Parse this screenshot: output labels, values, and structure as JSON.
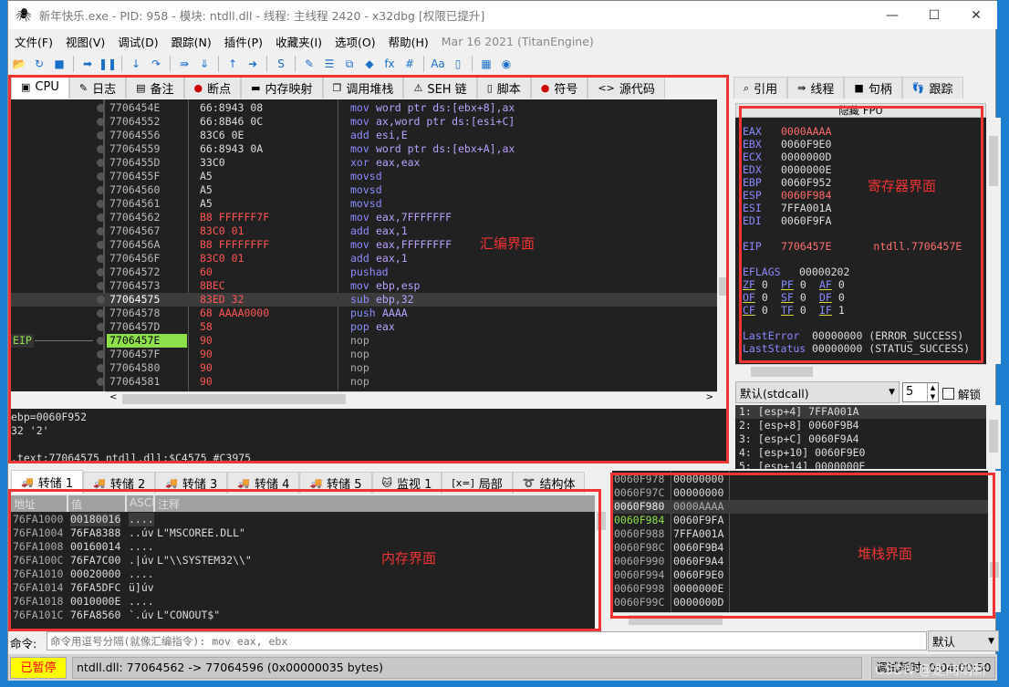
{
  "window": {
    "title": "新年快乐.exe - PID: 958 - 模块: ntdll.dll - 线程: 主线程 2420 - x32dbg [权限已提升]",
    "controls": {
      "minimize": "—",
      "maximize": "☐",
      "close": "✕"
    }
  },
  "menu": {
    "items": [
      "文件(F)",
      "视图(V)",
      "调试(D)",
      "跟踪(N)",
      "插件(P)",
      "收藏夹(I)",
      "选项(O)",
      "帮助(H)"
    ],
    "build": "Mar 16 2021 (TitanEngine)"
  },
  "toolbar": {
    "icons": [
      "open-icon",
      "restart-icon",
      "stop-icon",
      "|",
      "run-icon",
      "pause-icon",
      "|",
      "step-into-icon",
      "step-over-icon",
      "|",
      "trace-into-icon",
      "trace-over-icon",
      "|",
      "execute-till-return-icon",
      "run-to-user-code-icon",
      "|",
      "scylla-icon",
      "|",
      "patch-icon",
      "comment-icon",
      "label-icon",
      "bookmark-icon",
      "function-icon",
      "hash-icon",
      "|",
      "strings-icon",
      "memory-icon",
      "|",
      "calculator-icon",
      "globe-icon"
    ],
    "glyphs": {
      "open-icon": "📂",
      "restart-icon": "↻",
      "stop-icon": "■",
      "run-icon": "➡",
      "pause-icon": "❚❚",
      "step-into-icon": "↓",
      "step-over-icon": "↷",
      "trace-into-icon": "⇛",
      "trace-over-icon": "⇓",
      "execute-till-return-icon": "↑",
      "run-to-user-code-icon": "➜",
      "scylla-icon": "S",
      "patch-icon": "✎",
      "comment-icon": "☰",
      "label-icon": "⧉",
      "bookmark-icon": "◆",
      "function-icon": "fx",
      "hash-icon": "#",
      "strings-icon": "Aa",
      "memory-icon": "▯",
      "calculator-icon": "▦",
      "globe-icon": "◉"
    }
  },
  "main_tabs": [
    {
      "label": "CPU",
      "icon": "cpu-icon",
      "glyph": "▣",
      "active": true
    },
    {
      "label": "日志",
      "icon": "log-icon",
      "glyph": "✎"
    },
    {
      "label": "备注",
      "icon": "notes-icon",
      "glyph": "▤"
    },
    {
      "label": "断点",
      "icon": "breakpoint-icon",
      "glyph": "●"
    },
    {
      "label": "内存映射",
      "icon": "memory-map-icon",
      "glyph": "▬"
    },
    {
      "label": "调用堆栈",
      "icon": "call-stack-icon",
      "glyph": "❐"
    },
    {
      "label": "SEH 链",
      "icon": "seh-chain-icon",
      "glyph": "⚠"
    },
    {
      "label": "脚本",
      "icon": "script-icon",
      "glyph": "▯"
    },
    {
      "label": "符号",
      "icon": "symbols-icon",
      "glyph": "●"
    },
    {
      "label": "源代码",
      "icon": "source-icon",
      "glyph": "<>"
    }
  ],
  "side_tabs": [
    {
      "label": "引用",
      "icon": "references-icon",
      "glyph": "⌕"
    },
    {
      "label": "线程",
      "icon": "threads-icon",
      "glyph": "⇛"
    },
    {
      "label": "句柄",
      "icon": "handles-icon",
      "glyph": "■"
    },
    {
      "label": "跟踪",
      "icon": "trace-icon",
      "glyph": "👣"
    }
  ],
  "disassembly": {
    "eip_label": "EIP",
    "selected_address": "77064575",
    "eip_address": "7706457E",
    "rows": [
      {
        "addr": "7706454E",
        "bytes": "66:8943 08",
        "mn": "mov",
        "ops": "word ptr ds:[ebx+8],ax",
        "changed": false
      },
      {
        "addr": "77064552",
        "bytes": "66:8B46 0C",
        "mn": "mov",
        "ops": "ax,word ptr ds:[esi+C]",
        "changed": false
      },
      {
        "addr": "77064556",
        "bytes": "83C6 0E",
        "mn": "add",
        "ops": "esi,E",
        "changed": false
      },
      {
        "addr": "77064559",
        "bytes": "66:8943 0A",
        "mn": "mov",
        "ops": "word ptr ds:[ebx+A],ax",
        "changed": false
      },
      {
        "addr": "7706455D",
        "bytes": "33C0",
        "mn": "xor",
        "ops": "eax,eax",
        "changed": false
      },
      {
        "addr": "7706455F",
        "bytes": "A5",
        "mn": "movsd",
        "ops": "",
        "changed": false
      },
      {
        "addr": "77064560",
        "bytes": "A5",
        "mn": "movsd",
        "ops": "",
        "changed": false
      },
      {
        "addr": "77064561",
        "bytes": "A5",
        "mn": "movsd",
        "ops": "",
        "changed": false
      },
      {
        "addr": "77064562",
        "bytes": "B8 FFFFFF7F",
        "mn": "mov",
        "ops": "eax,7FFFFFFF",
        "changed": true
      },
      {
        "addr": "77064567",
        "bytes": "83C0 01",
        "mn": "add",
        "ops": "eax,1",
        "changed": true
      },
      {
        "addr": "7706456A",
        "bytes": "B8 FFFFFFFF",
        "mn": "mov",
        "ops": "eax,FFFFFFFF",
        "changed": true
      },
      {
        "addr": "7706456F",
        "bytes": "83C0 01",
        "mn": "add",
        "ops": "eax,1",
        "changed": true
      },
      {
        "addr": "77064572",
        "bytes": "60",
        "mn": "pushad",
        "ops": "",
        "changed": true
      },
      {
        "addr": "77064573",
        "bytes": "8BEC",
        "mn": "mov",
        "ops": "ebp,esp",
        "changed": true
      },
      {
        "addr": "77064575",
        "bytes": "83ED 32",
        "mn": "sub",
        "ops": "ebp,32",
        "changed": true
      },
      {
        "addr": "77064578",
        "bytes": "68 AAAA0000",
        "mn": "push",
        "ops": "AAAA",
        "changed": true
      },
      {
        "addr": "7706457D",
        "bytes": "58",
        "mn": "pop",
        "ops": "eax",
        "changed": true
      },
      {
        "addr": "7706457E",
        "bytes": "90",
        "mn": "nop",
        "ops": "",
        "changed": true
      },
      {
        "addr": "7706457F",
        "bytes": "90",
        "mn": "nop",
        "ops": "",
        "changed": true
      },
      {
        "addr": "77064580",
        "bytes": "90",
        "mn": "nop",
        "ops": "",
        "changed": true
      },
      {
        "addr": "77064581",
        "bytes": "90",
        "mn": "nop",
        "ops": "",
        "changed": true
      }
    ],
    "annotation": "汇编界面"
  },
  "info_pane": {
    "lines": [
      "ebp=0060F952",
      "32 '2'",
      "",
      ".text:77064575 ntdll.dll:$C4575 #C3975"
    ]
  },
  "registers": {
    "header": "隐藏 FPU",
    "gp": [
      {
        "name": "EAX",
        "value": "0000AAAA",
        "changed": true
      },
      {
        "name": "EBX",
        "value": "0060F9E0",
        "changed": false
      },
      {
        "name": "ECX",
        "value": "0000000D",
        "changed": false
      },
      {
        "name": "EDX",
        "value": "0000000E",
        "changed": false
      },
      {
        "name": "EBP",
        "value": "0060F952",
        "changed": false
      },
      {
        "name": "ESP",
        "value": "0060F984",
        "changed": true
      },
      {
        "name": "ESI",
        "value": "7FFA001A",
        "changed": false
      },
      {
        "name": "EDI",
        "value": "0060F9FA",
        "changed": false
      }
    ],
    "eip": {
      "name": "EIP",
      "value": "7706457E",
      "comment": "ntdll.7706457E"
    },
    "eflags": {
      "name": "EFLAGS",
      "value": "00000202"
    },
    "flags": [
      [
        {
          "n": "ZF",
          "v": "0"
        },
        {
          "n": "PF",
          "v": "0"
        },
        {
          "n": "AF",
          "v": "0"
        }
      ],
      [
        {
          "n": "OF",
          "v": "0"
        },
        {
          "n": "SF",
          "v": "0"
        },
        {
          "n": "DF",
          "v": "0"
        }
      ],
      [
        {
          "n": "CF",
          "v": "0"
        },
        {
          "n": "TF",
          "v": "0"
        },
        {
          "n": "IF",
          "v": "1"
        }
      ]
    ],
    "last_error": {
      "name": "LastError",
      "value": "00000000 (ERROR_SUCCESS)"
    },
    "last_status": {
      "name": "LastStatus",
      "value": "00000000 (STATUS_SUCCESS)"
    },
    "annotation": "寄存器界面"
  },
  "callconv": {
    "selected": "默认(stdcall)",
    "count": "5",
    "unlock_label": "解锁",
    "unlock_checked": false,
    "args": [
      "1: [esp+4] 7FFA001A",
      "2: [esp+8] 0060F9B4",
      "3: [esp+C] 0060F9A4",
      "4: [esp+10] 0060F9E0",
      "5: [esp+14] 0000000E"
    ]
  },
  "dump_tabs": [
    {
      "label": "转储 1",
      "icon": "dump-icon",
      "glyph": "🚚",
      "active": true
    },
    {
      "label": "转储 2",
      "icon": "dump-icon",
      "glyph": "🚚"
    },
    {
      "label": "转储 3",
      "icon": "dump-icon",
      "glyph": "🚚"
    },
    {
      "label": "转储 4",
      "icon": "dump-icon",
      "glyph": "🚚"
    },
    {
      "label": "转储 5",
      "icon": "dump-icon",
      "glyph": "🚚"
    },
    {
      "label": "监视 1",
      "icon": "watch-icon",
      "glyph": "🐱"
    },
    {
      "label": "局部",
      "icon": "locals-icon",
      "glyph": "[x=]"
    },
    {
      "label": "结构体",
      "icon": "struct-icon",
      "glyph": "➰"
    }
  ],
  "dump": {
    "columns": [
      "地址",
      "值",
      "ASCI",
      "注释"
    ],
    "rows": [
      {
        "addr": "76FA1000",
        "val": "00180016",
        "ascii": "....",
        "comment": ""
      },
      {
        "addr": "76FA1004",
        "val": "76FA8388",
        "ascii": "..úv",
        "comment": "L\"MSCOREE.DLL\""
      },
      {
        "addr": "76FA1008",
        "val": "00160014",
        "ascii": "....",
        "comment": ""
      },
      {
        "addr": "76FA100C",
        "val": "76FA7C00",
        "ascii": ".|úv",
        "comment": "L\"\\\\SYSTEM32\\\\\""
      },
      {
        "addr": "76FA1010",
        "val": "00020000",
        "ascii": "....",
        "comment": ""
      },
      {
        "addr": "76FA1014",
        "val": "76FA5DFC",
        "ascii": "ü]úv",
        "comment": ""
      },
      {
        "addr": "76FA1018",
        "val": "0010000E",
        "ascii": "....",
        "comment": ""
      },
      {
        "addr": "76FA101C",
        "val": "76FA8560",
        "ascii": "`.úv",
        "comment": "L\"CONOUT$\""
      }
    ],
    "annotation": "内存界面"
  },
  "stack": {
    "rows": [
      {
        "addr": "0060F978",
        "val": "00000000"
      },
      {
        "addr": "0060F97C",
        "val": "00000000"
      },
      {
        "addr": "0060F980",
        "val": "0000AAAA",
        "selected": true
      },
      {
        "addr": "0060F984",
        "val": "0060F9FA",
        "esp": true
      },
      {
        "addr": "0060F988",
        "val": "7FFA001A"
      },
      {
        "addr": "0060F98C",
        "val": "0060F9B4"
      },
      {
        "addr": "0060F990",
        "val": "0060F9A4"
      },
      {
        "addr": "0060F994",
        "val": "0060F9E0"
      },
      {
        "addr": "0060F998",
        "val": "0000000E"
      },
      {
        "addr": "0060F99C",
        "val": "0000000D"
      }
    ],
    "annotation": "堆栈界面"
  },
  "command": {
    "label": "命令:",
    "placeholder": "命令用逗号分隔(就像汇编指令): mov eax, ebx",
    "mode": "默认"
  },
  "status": {
    "state": "已暂停",
    "message": "ntdll.dll: 77064562 -> 77064596 (0x00000035 bytes)",
    "time": "调试耗时: 0:04:00:50",
    "watermark": "CSDN @逆向萌新"
  },
  "colors": {
    "paused_bg": "#ffff00",
    "paused_fg": "#ff0000",
    "eip_highlight": "#8ee04a",
    "changed": "#ff6a6a",
    "reg_name": "#8a8aff",
    "annotation": "#f03434"
  }
}
